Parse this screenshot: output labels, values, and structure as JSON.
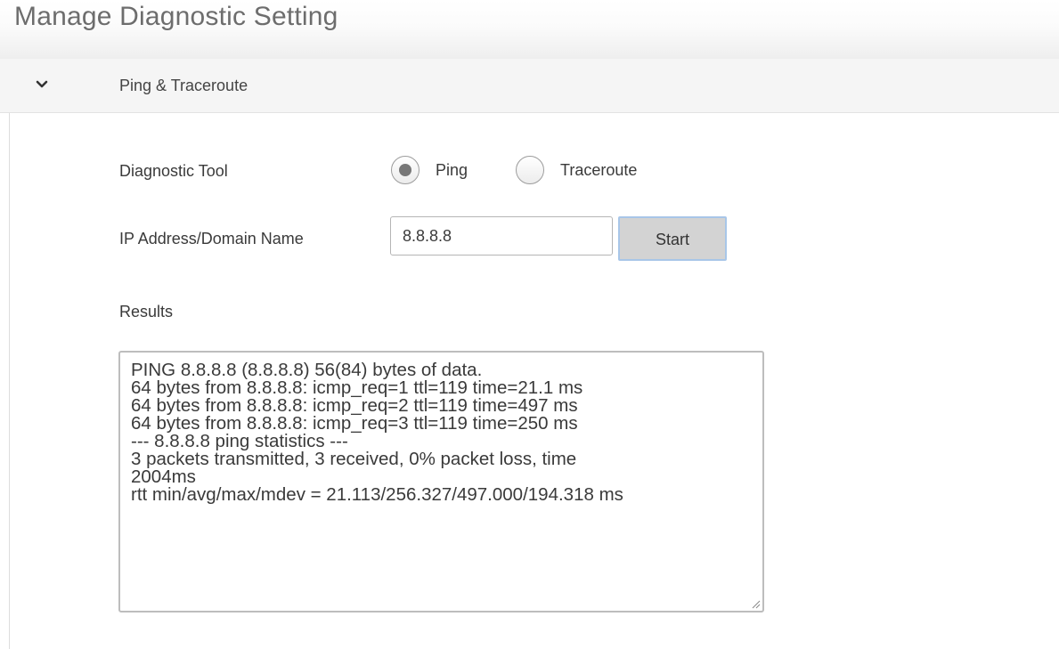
{
  "page": {
    "title": "Manage Diagnostic Setting"
  },
  "section": {
    "title": "Ping & Traceroute",
    "expanded": true,
    "toggle_icon": "chevron-down-icon"
  },
  "form": {
    "diagnostic_tool_label": "Diagnostic Tool",
    "tool_options": [
      {
        "label": "Ping",
        "selected": true
      },
      {
        "label": "Traceroute",
        "selected": false
      }
    ],
    "ip_label": "IP Address/Domain Name",
    "ip_value": "8.8.8.8",
    "start_label": "Start",
    "results_label": "Results"
  },
  "results": {
    "lines": [
      "PING 8.8.8.8 (8.8.8.8) 56(84) bytes of data.",
      "64 bytes from 8.8.8.8: icmp_req=1 ttl=119 time=21.1 ms",
      "64 bytes from 8.8.8.8: icmp_req=2 ttl=119 time=497 ms",
      "64 bytes from 8.8.8.8: icmp_req=3 ttl=119 time=250 ms",
      "--- 8.8.8.8 ping statistics ---",
      "3 packets transmitted, 3 received, 0% packet loss, time",
      "2004ms",
      "rtt min/avg/max/mdev = 21.113/256.327/497.000/194.318 ms"
    ]
  },
  "colors": {
    "button_border": "#a8c6e8",
    "button_fill": "#d3d3d3",
    "header_fill": "#f5f5f5"
  }
}
